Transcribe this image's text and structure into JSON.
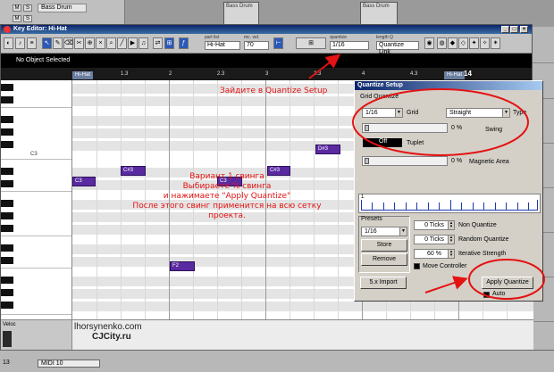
{
  "arrange": {
    "track_name": "Bass Drum",
    "clip_labels": [
      "Bass Drum",
      "Bass Drum"
    ],
    "mute_label": "M",
    "solo_label": "S"
  },
  "key_editor": {
    "title": "Key Editor: Hi-Hat",
    "toolbar": {
      "part_list_label": "part list",
      "part_list_value": "Hi-Hat",
      "mc_vel_label": "mc. vel.",
      "mc_vel_value": "70",
      "quantize_label": "quantize",
      "quantize_value": "1/16",
      "length_q_label": "length Q",
      "length_q_value": "Quantize Link"
    },
    "status": "No Object Selected",
    "ruler": {
      "ticks": [
        "1.3",
        "2",
        "2.3",
        "3",
        "3.3",
        "4",
        "4.3"
      ],
      "part_tag_left": "Hi-Hat",
      "part_tag_right": "Hi-Hat",
      "end_number": "14"
    },
    "piano_label": "C3",
    "notes": [
      {
        "label": "C3"
      },
      {
        "label": "C#3"
      },
      {
        "label": "C3"
      },
      {
        "label": "C#3"
      },
      {
        "label": "D#3"
      },
      {
        "label": "F2"
      }
    ],
    "velocity_label": "Veloc"
  },
  "annotations": {
    "go_to": "Зайдите в Quantize Setup",
    "swing_lines": [
      "Вариант 1 свинга",
      "Выбираете % свинга",
      "и нажимаете \"Apply Quantize\"",
      "После этого свинг применится на всю сетку проекта."
    ],
    "watermark_1": "lhorsynenko.com",
    "watermark_2": "CJCity.ru"
  },
  "quantize_setup": {
    "title": "Quantize Setup",
    "grid_quantize_label": "Grid Quantize",
    "grid_value": "1/16",
    "grid_label": "Grid",
    "type_value": "Straight",
    "type_label": "Type",
    "swing_value": "0 %",
    "swing_label": "Swing",
    "tuplet_value": "Off",
    "tuplet_label": "Tuplet",
    "magnetic_value": "0 %",
    "magnetic_label": "Magnetic Area",
    "grid_start_label": "1",
    "presets_label": "Presets",
    "preset_value": "1/16",
    "store_label": "Store",
    "remove_label": "Remove",
    "non_quantize_value": "0 Ticks",
    "non_quantize_label": "Non Quantize",
    "random_quantize_value": "0 Ticks",
    "random_quantize_label": "Random Quantize",
    "iterative_value": "60 %",
    "iterative_label": "Iterative Strength",
    "move_controller_label": "Move Controller",
    "import_label": "5.x Import",
    "apply_label": "Apply Quantize",
    "auto_label": "Auto"
  },
  "bottom": {
    "track_number": "13",
    "midi_value": "MIDI 10"
  },
  "colors": {
    "note": "#5a2aa0",
    "annotation_red": "#e41212",
    "title_blue": "#0a246a"
  }
}
